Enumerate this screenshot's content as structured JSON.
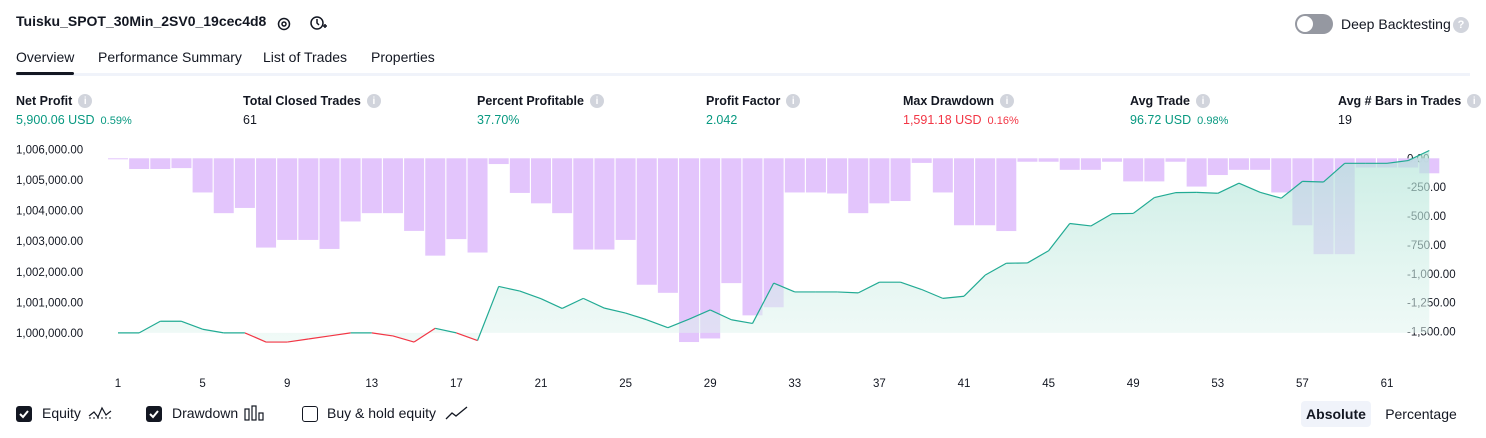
{
  "header": {
    "title": "Tuisku_SPOT_30Min_2SV0_19cec4d8",
    "deep_backtesting_label": "Deep Backtesting",
    "deep_backtesting_on": false
  },
  "tabs": [
    "Overview",
    "Performance Summary",
    "List of Trades",
    "Properties"
  ],
  "active_tab": "Overview",
  "metrics": [
    {
      "label": "Net Profit",
      "value": "5,900.06 USD",
      "pct": "0.59%",
      "color": "green"
    },
    {
      "label": "Total Closed Trades",
      "value": "61",
      "pct": "",
      "color": "dark"
    },
    {
      "label": "Percent Profitable",
      "value": "37.70%",
      "pct": "",
      "color": "green"
    },
    {
      "label": "Profit Factor",
      "value": "2.042",
      "pct": "",
      "color": "green"
    },
    {
      "label": "Max Drawdown",
      "value": "1,591.18 USD",
      "pct": "0.16%",
      "color": "red"
    },
    {
      "label": "Avg Trade",
      "value": "96.72 USD",
      "pct": "0.98%",
      "color": "green"
    },
    {
      "label": "Avg # Bars in Trades",
      "value": "19",
      "pct": "",
      "color": "dark"
    }
  ],
  "chart_data": {
    "type": "line",
    "x_ticks": [
      "1",
      "5",
      "9",
      "13",
      "17",
      "21",
      "25",
      "29",
      "33",
      "37",
      "41",
      "45",
      "49",
      "53",
      "57",
      "61"
    ],
    "x_range": [
      0,
      64
    ],
    "left_axis_ticks": [
      "1,006,000.00",
      "1,005,000.00",
      "1,004,000.00",
      "1,003,000.00",
      "1,002,000.00",
      "1,001,000.00",
      "1,000,000.00"
    ],
    "left_ylim": [
      999440,
      1006150
    ],
    "right_axis_ticks": [
      "0.00",
      "-250.00",
      "-500.00",
      "-750.00",
      "-1,000.00",
      "-1,250.00",
      "-1,500.00"
    ],
    "right_ylim": [
      -1660,
      115
    ],
    "series": [
      {
        "name": "Equity",
        "x": [
          1,
          2,
          3,
          4,
          5,
          6,
          7,
          8,
          9,
          10,
          11,
          12,
          13,
          14,
          15,
          16,
          17,
          18,
          19,
          20,
          21,
          22,
          23,
          24,
          25,
          26,
          27,
          28,
          29,
          30,
          31,
          32,
          33,
          34,
          35,
          36,
          37,
          38,
          39,
          40,
          41,
          42,
          43,
          44,
          45,
          46,
          47,
          48,
          49,
          50,
          51,
          52,
          53,
          54,
          55,
          56,
          57,
          58,
          59,
          60,
          61,
          62,
          63
        ],
        "values": [
          1000000,
          1000000,
          1000380,
          1000380,
          1000120,
          1000000,
          1000000,
          999700,
          999700,
          999800,
          999900,
          1000000,
          1000000,
          999900,
          999700,
          1000150,
          1000000,
          999750,
          1001520,
          1001370,
          1001120,
          1000800,
          1001130,
          1000810,
          1000650,
          1000430,
          1000170,
          1000450,
          1000750,
          1000430,
          1000310,
          1001630,
          1001340,
          1001340,
          1001340,
          1001310,
          1001660,
          1001660,
          1001420,
          1001130,
          1001200,
          1001890,
          1002280,
          1002290,
          1002690,
          1003580,
          1003500,
          1003900,
          1003910,
          1004430,
          1004590,
          1004600,
          1004570,
          1004900,
          1004600,
          1004410,
          1004960,
          1004940,
          1005550,
          1005550,
          1005550,
          1005640,
          1005970
        ]
      },
      {
        "name": "Drawdown",
        "x": [
          1,
          2,
          3,
          4,
          5,
          6,
          7,
          8,
          9,
          10,
          11,
          12,
          13,
          14,
          15,
          16,
          17,
          18,
          19,
          20,
          21,
          22,
          23,
          24,
          25,
          26,
          27,
          28,
          29,
          30,
          31,
          32,
          33,
          34,
          35,
          36,
          37,
          38,
          39,
          40,
          41,
          42,
          43,
          44,
          45,
          46,
          47,
          48,
          49,
          50,
          51,
          52,
          53,
          54,
          55,
          56,
          57,
          58,
          59,
          60,
          61,
          62,
          63
        ],
        "values": [
          0,
          -93,
          -93,
          -85,
          -296,
          -475,
          -430,
          -773,
          -707,
          -707,
          -785,
          -547,
          -475,
          -475,
          -629,
          -843,
          -700,
          -816,
          -50,
          -300,
          -390,
          -475,
          -790,
          -790,
          -707,
          -1095,
          -1165,
          -1591,
          -1560,
          -1081,
          -1360,
          -1290,
          -296,
          -296,
          -305,
          -475,
          -390,
          -370,
          -40,
          -296,
          -580,
          -580,
          -630,
          -30,
          -30,
          -100,
          -100,
          -30,
          -200,
          -200,
          -30,
          -245,
          -145,
          -100,
          -100,
          -296,
          -580,
          -830,
          -830,
          -80,
          -80,
          -80,
          -130
        ]
      }
    ],
    "legend": [
      "Equity",
      "Drawdown",
      "Buy & hold equity"
    ],
    "legend_checked": [
      true,
      true,
      false
    ],
    "colors": {
      "equity_up": "#22ab94",
      "equity_down": "#f23645",
      "equity_fill": "#d7f1ea",
      "drawdown": "#e1c2fc"
    }
  },
  "legend": {
    "equity_label": "Equity",
    "drawdown_label": "Drawdown",
    "buyhold_label": "Buy & hold equity"
  },
  "modes": {
    "absolute_label": "Absolute",
    "percentage_label": "Percentage",
    "selected": "Absolute"
  }
}
